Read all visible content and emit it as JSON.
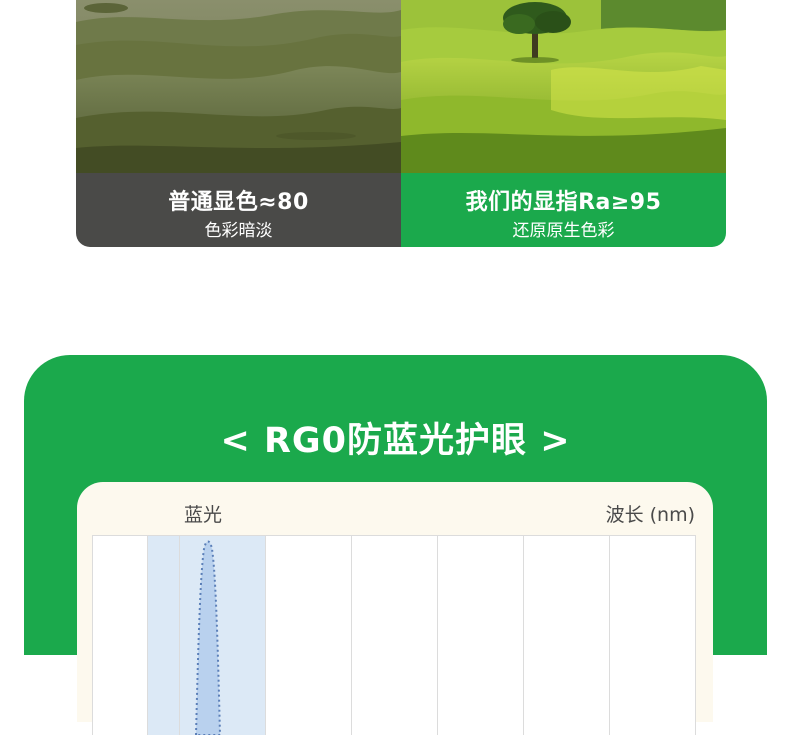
{
  "comparison": {
    "left": {
      "title": "普通显色≈80",
      "subtitle": "色彩暗淡"
    },
    "right": {
      "title": "我们的显指Ra≥95",
      "subtitle": "还原原生色彩"
    }
  },
  "eye_care": {
    "title": "< RG0防蓝光护眼 >",
    "chart": {
      "series_label": "蓝光",
      "x_axis_label": "波长 (nm)"
    }
  },
  "colors": {
    "brand_green": "#1ba94c",
    "dark_caption": "#4a4a48",
    "card_bg": "#fdf9ee",
    "blue_band": "#dce9f6",
    "curve": "#5b7fb8"
  }
}
